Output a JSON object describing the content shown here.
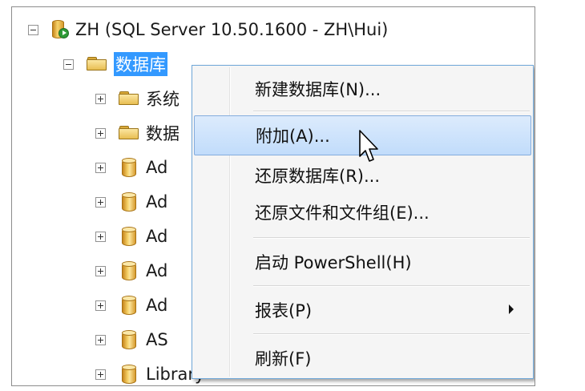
{
  "tree": {
    "server_label": "ZH (SQL Server 10.50.1600 - ZH\\Hui)",
    "databases_label": "数据库",
    "children": [
      {
        "label": "系统",
        "type": "folder"
      },
      {
        "label": "数据",
        "type": "folder"
      },
      {
        "label": "Ad",
        "type": "db"
      },
      {
        "label": "Ad",
        "type": "db"
      },
      {
        "label": "Ad",
        "type": "db"
      },
      {
        "label": "Ad",
        "type": "db"
      },
      {
        "label": "Ad",
        "type": "db"
      },
      {
        "label": "AS",
        "type": "db"
      },
      {
        "label": "Library",
        "type": "db"
      }
    ]
  },
  "context_menu": {
    "items": [
      {
        "label": "新建数据库(N)..."
      },
      {
        "label": "附加(A)..."
      },
      {
        "label": "还原数据库(R)..."
      },
      {
        "label": "还原文件和文件组(E)..."
      },
      {
        "label": "启动 PowerShell(H)"
      },
      {
        "label": "报表(P)"
      },
      {
        "label": "刷新(F)"
      }
    ],
    "highlighted_index": 1
  },
  "colors": {
    "selection": "#3399ff",
    "menu_highlight": "#c1dcfb",
    "menu_border": "#6fa7d8"
  }
}
